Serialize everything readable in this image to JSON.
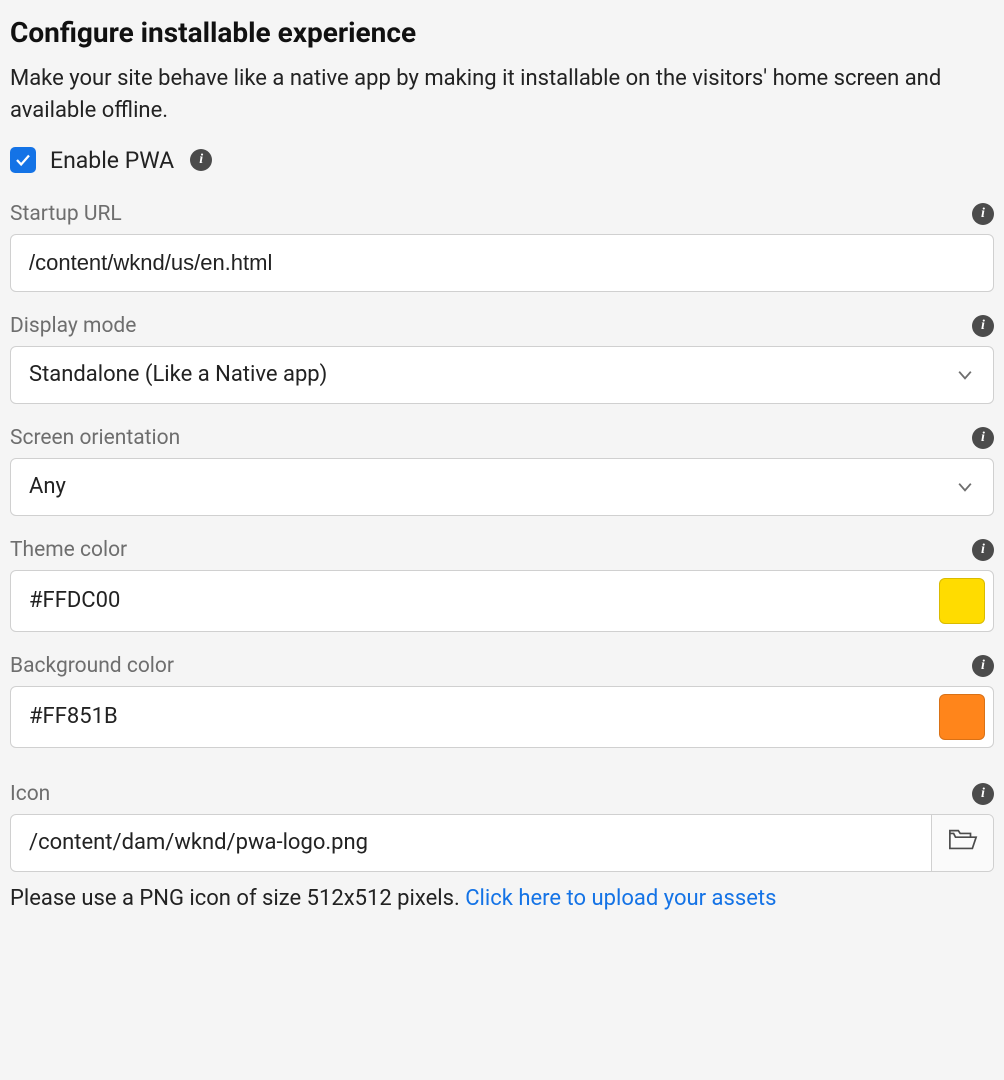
{
  "title": "Configure installable experience",
  "description": "Make your site behave like a native app by making it installable on the visitors' home screen and available offline.",
  "enable_pwa": {
    "label": "Enable PWA",
    "checked": true
  },
  "fields": {
    "startup_url": {
      "label": "Startup URL",
      "value": "/content/wknd/us/en.html"
    },
    "display_mode": {
      "label": "Display mode",
      "value": "Standalone (Like a Native app)"
    },
    "screen_orientation": {
      "label": "Screen orientation",
      "value": "Any"
    },
    "theme_color": {
      "label": "Theme color",
      "value": "#FFDC00",
      "swatch": "#FFDC00"
    },
    "background_color": {
      "label": "Background color",
      "value": "#FF851B",
      "swatch": "#FF851B"
    },
    "icon": {
      "label": "Icon",
      "value": "/content/dam/wknd/pwa-logo.png"
    }
  },
  "hint": {
    "prefix": "Please use a PNG icon of size 512x512 pixels. ",
    "link": "Click here to upload your assets"
  }
}
